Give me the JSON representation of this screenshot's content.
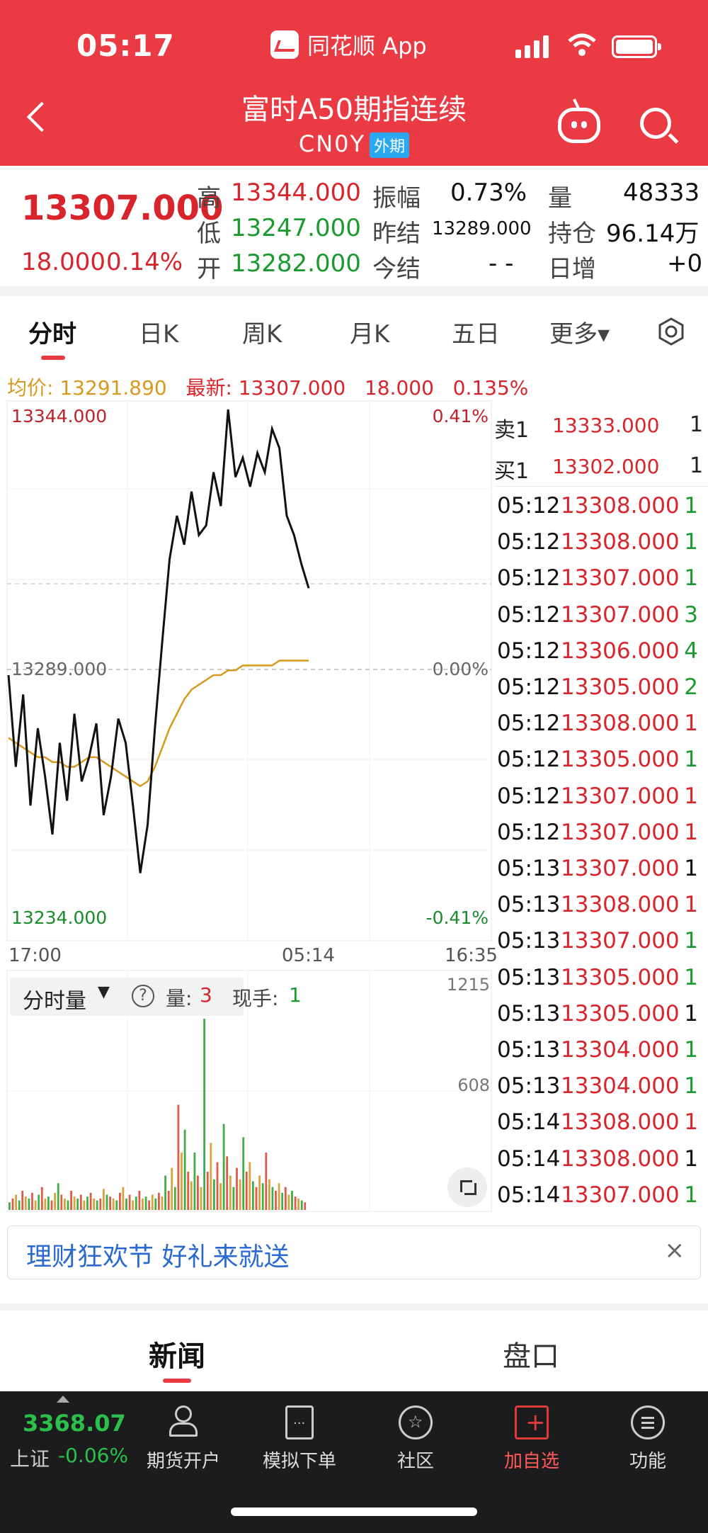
{
  "status_bar": {
    "time": "05:17",
    "app_name": "同花顺 App"
  },
  "header": {
    "title": "富时A50期指连续",
    "code": "CN0Y",
    "tag": "外期"
  },
  "quote": {
    "price": "13307.000",
    "change": "18.000",
    "change_pct": "0.14%",
    "fields": [
      {
        "label": "高",
        "value": "13344.000"
      },
      {
        "label": "低",
        "value": "13247.000"
      },
      {
        "label": "开",
        "value": "13282.000"
      },
      {
        "label": "振幅",
        "value": "0.73%"
      },
      {
        "label": "昨结",
        "value": "13289.000"
      },
      {
        "label": "今结",
        "value": "- -"
      },
      {
        "label": "量",
        "value": "48333"
      },
      {
        "label": "持仓",
        "value": "96.14万"
      },
      {
        "label": "日增",
        "value": "+0"
      }
    ]
  },
  "tabs": [
    "分时",
    "日K",
    "周K",
    "月K",
    "五日",
    "更多▾"
  ],
  "chart_info": {
    "avg_label": "均价: 13291.890",
    "latest_label": "最新: 13307.000",
    "latest_change": "18.000",
    "latest_pct": "0.135%"
  },
  "chart_data": {
    "type": "line",
    "y_top_label": "13344.000",
    "y_bottom_label": "13234.000",
    "y_mid_label": "13289.000",
    "pct_top": "0.41%",
    "pct_mid": "0.00%",
    "pct_bottom": "-0.41%",
    "ylim": [
      13234,
      13344
    ],
    "x_ticks": [
      "17:00",
      "05:14",
      "16:35"
    ],
    "series": [
      {
        "values": [
          13289,
          13270,
          13285,
          13262,
          13278,
          13268,
          13256,
          13275,
          13263,
          13281,
          13267,
          13272,
          13279,
          13260,
          13268,
          13280,
          13275,
          13262,
          13248,
          13258,
          13278,
          13296,
          13313,
          13322,
          13316,
          13327,
          13318,
          13320,
          13331,
          13324,
          13344,
          13330,
          13334,
          13328,
          13335,
          13331,
          13340,
          13336,
          13322,
          13318,
          13312,
          13307
        ]
      },
      {
        "values": [
          13276,
          13275,
          13274,
          13273,
          13272,
          13272,
          13271,
          13271,
          13270,
          13270,
          13271,
          13272,
          13272,
          13271,
          13270,
          13269,
          13268,
          13267,
          13266,
          13267,
          13270,
          13274,
          13278,
          13281,
          13284,
          13286,
          13287,
          13288,
          13289,
          13289,
          13290,
          13290,
          13291,
          13291,
          13291,
          13291,
          13291,
          13292,
          13292,
          13292,
          13292,
          13292
        ]
      }
    ]
  },
  "orderbook": {
    "sell_label": "卖1",
    "sell_price": "13333.000",
    "sell_vol": "1",
    "buy_label": "买1",
    "buy_price": "13302.000",
    "buy_vol": "1"
  },
  "trades": [
    {
      "time": "05:12",
      "price": "13308.000",
      "vol": "1",
      "color": "#1a9a2f"
    },
    {
      "time": "05:12",
      "price": "13308.000",
      "vol": "1",
      "color": "#1a9a2f"
    },
    {
      "time": "05:12",
      "price": "13307.000",
      "vol": "1",
      "color": "#1a9a2f"
    },
    {
      "time": "05:12",
      "price": "13307.000",
      "vol": "3",
      "color": "#1a9a2f"
    },
    {
      "time": "05:12",
      "price": "13306.000",
      "vol": "4",
      "color": "#1a9a2f"
    },
    {
      "time": "05:12",
      "price": "13305.000",
      "vol": "2",
      "color": "#1a9a2f"
    },
    {
      "time": "05:12",
      "price": "13308.000",
      "vol": "1",
      "color": "#d8252c"
    },
    {
      "time": "05:12",
      "price": "13305.000",
      "vol": "1",
      "color": "#1a9a2f"
    },
    {
      "time": "05:12",
      "price": "13307.000",
      "vol": "1",
      "color": "#d8252c"
    },
    {
      "time": "05:12",
      "price": "13307.000",
      "vol": "1",
      "color": "#d8252c"
    },
    {
      "time": "05:13",
      "price": "13307.000",
      "vol": "1",
      "color": "#111111"
    },
    {
      "time": "05:13",
      "price": "13308.000",
      "vol": "1",
      "color": "#d8252c"
    },
    {
      "time": "05:13",
      "price": "13307.000",
      "vol": "1",
      "color": "#1a9a2f"
    },
    {
      "time": "05:13",
      "price": "13305.000",
      "vol": "1",
      "color": "#1a9a2f"
    },
    {
      "time": "05:13",
      "price": "13305.000",
      "vol": "1",
      "color": "#111111"
    },
    {
      "time": "05:13",
      "price": "13304.000",
      "vol": "1",
      "color": "#1a9a2f"
    },
    {
      "time": "05:13",
      "price": "13304.000",
      "vol": "1",
      "color": "#1a9a2f"
    },
    {
      "time": "05:14",
      "price": "13308.000",
      "vol": "1",
      "color": "#d8252c"
    },
    {
      "time": "05:14",
      "price": "13308.000",
      "vol": "1",
      "color": "#111111"
    },
    {
      "time": "05:14",
      "price": "13307.000",
      "vol": "1",
      "color": "#1a9a2f"
    }
  ],
  "volume": {
    "selector": "分时量",
    "help": "?",
    "qty_label": "量:",
    "qty_value": "3",
    "hand_label": "现手:",
    "hand_value": "1",
    "max_label": "1215",
    "mid_label": "608",
    "bars": [
      0.04,
      0.06,
      0.08,
      0.05,
      0.1,
      0.07,
      0.06,
      0.09,
      0.05,
      0.08,
      0.12,
      0.06,
      0.07,
      0.05,
      0.09,
      0.14,
      0.08,
      0.06,
      0.05,
      0.1,
      0.07,
      0.06,
      0.08,
      0.05,
      0.07,
      0.09,
      0.06,
      0.05,
      0.06,
      0.11,
      0.08,
      0.07,
      0.06,
      0.05,
      0.09,
      0.12,
      0.06,
      0.08,
      0.05,
      0.07,
      0.1,
      0.06,
      0.07,
      0.05,
      0.08,
      0.06,
      0.09,
      0.07,
      0.18,
      0.1,
      0.22,
      0.12,
      0.55,
      0.3,
      0.42,
      0.2,
      0.15,
      0.3,
      0.18,
      0.12,
      1.0,
      0.2,
      0.35,
      0.16,
      0.25,
      0.14,
      0.45,
      0.28,
      0.18,
      0.12,
      0.22,
      0.16,
      0.38,
      0.2,
      0.25,
      0.15,
      0.12,
      0.18,
      0.14,
      0.3,
      0.16,
      0.12,
      0.1,
      0.14,
      0.09,
      0.12,
      0.08,
      0.1,
      0.07,
      0.06,
      0.05,
      0.04
    ]
  },
  "banner": {
    "text": "理财狂欢节 好礼来就送",
    "close": "×"
  },
  "bottom_tabs": [
    "新闻",
    "盘口"
  ],
  "bottom_bar": {
    "index_value": "3368.07",
    "index_name": "上证",
    "index_change": "-0.06%",
    "items": [
      "期货开户",
      "模拟下单",
      "社区",
      "加自选",
      "功能"
    ]
  }
}
